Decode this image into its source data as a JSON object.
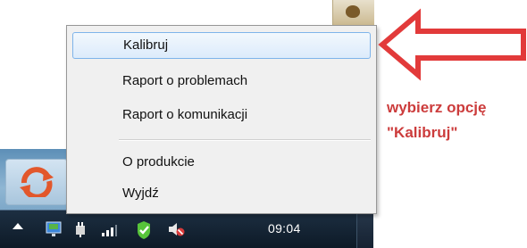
{
  "menu": {
    "items": [
      {
        "label": "Kalibruj",
        "highlighted": true
      },
      {
        "label": "Raport o problemach"
      },
      {
        "label": "Raport o komunikacji"
      },
      {
        "label": "O produkcie"
      },
      {
        "label": "Wyjdź"
      }
    ]
  },
  "annotation": {
    "line1": "wybierz opcję",
    "line2": "\"Kalibruj\""
  },
  "taskbar": {
    "clock": "09:04"
  },
  "colors": {
    "arrow": "#e23a3a",
    "annotation_text": "#cc3c3c",
    "taskbar": "#0d1a27",
    "menu_highlight_border": "#7eb4ea"
  },
  "icons": {
    "top_icon": "app-tray-icon",
    "app": "refresh-app-icon",
    "tray": [
      "show-hidden-icons",
      "network-monitor-icon",
      "power-plug-icon",
      "signal-bars-icon",
      "security-shield-icon",
      "volume-muted-icon"
    ]
  }
}
